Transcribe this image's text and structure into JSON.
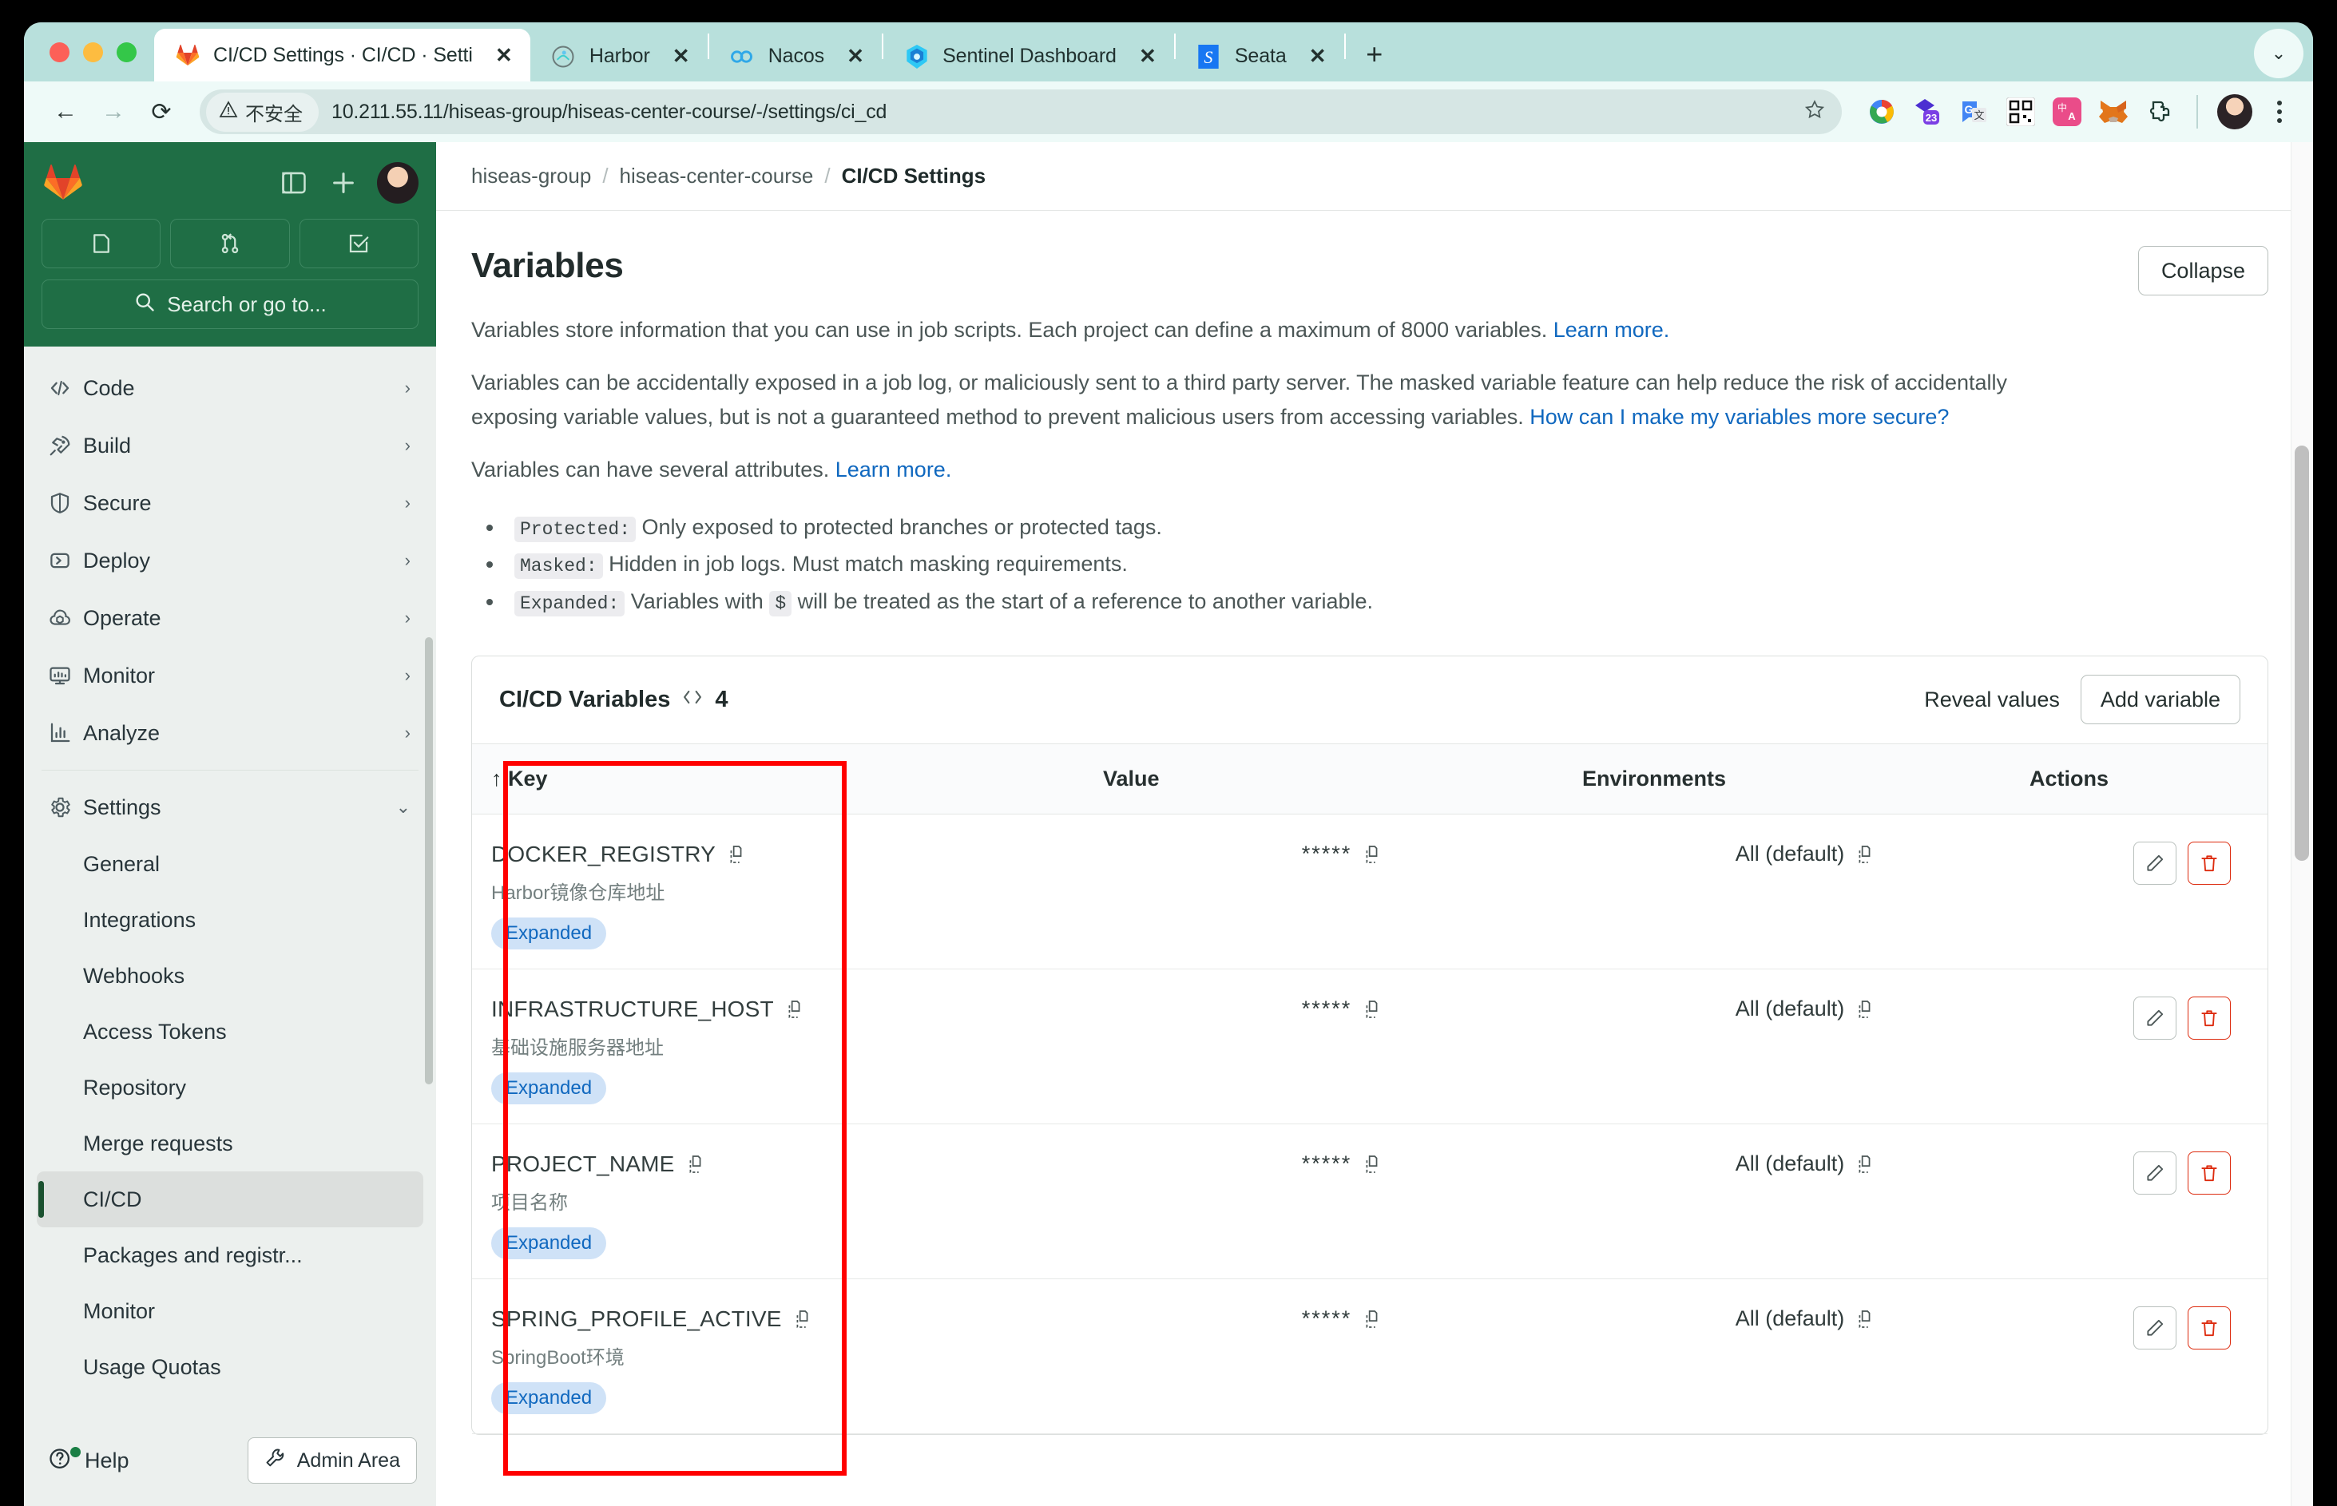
{
  "browser": {
    "tabs": [
      {
        "title": "CI/CD Settings · CI/CD · Setti",
        "favicon": "gitlab-icon",
        "active": true,
        "close_label": "✕"
      },
      {
        "title": "Harbor",
        "favicon": "harbor-icon",
        "active": false,
        "close_label": "✕"
      },
      {
        "title": "Nacos",
        "favicon": "nacos-icon",
        "active": false,
        "close_label": "✕"
      },
      {
        "title": "Sentinel Dashboard",
        "favicon": "sentinel-icon",
        "active": false,
        "close_label": "✕"
      },
      {
        "title": "Seata",
        "favicon": "seata-icon",
        "active": false,
        "close_label": "✕"
      }
    ],
    "new_tab_label": "+",
    "tab_list_chevron": "⌄",
    "nav": {
      "back": "←",
      "forward": "→",
      "reload": "⟳"
    },
    "omnibox": {
      "security_label": "不安全",
      "security_icon": "warning-triangle-icon",
      "url": "10.211.55.11/hiseas-group/hiseas-center-course/-/settings/ci_cd",
      "bookmark_icon": "star-icon"
    },
    "extensions": [
      "chrome-profile-icon",
      "super-extension-23-icon",
      "google-translate-icon",
      "qr-code-icon",
      "immersive-translate-icon",
      "metamask-fox-icon",
      "puzzle-extension-icon"
    ],
    "menu_icon": "kebab-menu-icon"
  },
  "sidebar": {
    "logo": "gitlab-logo-icon",
    "toggle_icon": "sidebar-toggle-icon",
    "create_icon": "plus-icon",
    "avatar": "user-avatar",
    "quick_actions": [
      "issues-icon",
      "merge-requests-icon",
      "todos-icon"
    ],
    "search_placeholder": "Search or go to...",
    "search_icon": "search-icon",
    "items": [
      {
        "label": "Code",
        "icon": "code-icon",
        "chevron": "›"
      },
      {
        "label": "Build",
        "icon": "rocket-icon",
        "chevron": "›"
      },
      {
        "label": "Secure",
        "icon": "shield-icon",
        "chevron": "›"
      },
      {
        "label": "Deploy",
        "icon": "deploy-icon",
        "chevron": "›"
      },
      {
        "label": "Operate",
        "icon": "cloud-pod-icon",
        "chevron": "›"
      },
      {
        "label": "Monitor",
        "icon": "monitor-icon",
        "chevron": "›"
      },
      {
        "label": "Analyze",
        "icon": "chart-icon",
        "chevron": "›"
      }
    ],
    "settings": {
      "label": "Settings",
      "icon": "gear-icon",
      "chevron": "⌄"
    },
    "settings_items": [
      {
        "label": "General",
        "active": false
      },
      {
        "label": "Integrations",
        "active": false
      },
      {
        "label": "Webhooks",
        "active": false
      },
      {
        "label": "Access Tokens",
        "active": false
      },
      {
        "label": "Repository",
        "active": false
      },
      {
        "label": "Merge requests",
        "active": false
      },
      {
        "label": "CI/CD",
        "active": true
      },
      {
        "label": "Packages and registr...",
        "active": false
      },
      {
        "label": "Monitor",
        "active": false
      },
      {
        "label": "Usage Quotas",
        "active": false
      }
    ],
    "help_label": "Help",
    "help_icon": "question-circle-icon",
    "admin_label": "Admin Area",
    "admin_icon": "wrench-icon"
  },
  "breadcrumb": {
    "items": [
      "hiseas-group",
      "hiseas-center-course"
    ],
    "current": "CI/CD Settings",
    "separator": "/"
  },
  "main": {
    "title": "Variables",
    "collapse_label": "Collapse",
    "desc1_text": "Variables store information that you can use in job scripts. Each project can define a maximum of 8000 variables. ",
    "desc1_link": "Learn more.",
    "desc2_text": "Variables can be accidentally exposed in a job log, or maliciously sent to a third party server. The masked variable feature can help reduce the risk of accidentally exposing variable values, but is not a guaranteed method to prevent malicious users from accessing variables. ",
    "desc2_link": "How can I make my variables more secure?",
    "desc3_text": "Variables can have several attributes. ",
    "desc3_link": "Learn more.",
    "attributes": [
      {
        "code": "Protected:",
        "text": " Only exposed to protected branches or protected tags."
      },
      {
        "code": "Masked:",
        "text": " Hidden in job logs. Must match masking requirements."
      },
      {
        "code": "Expanded:",
        "text_before": " Variables with ",
        "inline_code": "$",
        "text_after": " will be treated as the start of a reference to another variable."
      }
    ]
  },
  "variables_card": {
    "heading": "CI/CD Variables",
    "heading_icon": "code-brackets-icon",
    "count": "4",
    "reveal_label": "Reveal values",
    "add_label": "Add variable",
    "columns": {
      "key": "Key",
      "key_sort_icon": "↑",
      "value": "Value",
      "environments": "Environments",
      "actions": "Actions"
    },
    "rows": [
      {
        "key": "DOCKER_REGISTRY",
        "description": "Harbor镜像仓库地址",
        "badge": "Expanded",
        "value": "*****",
        "environment": "All (default)",
        "copy_icon": "copy-icon",
        "edit_icon": "pencil-icon",
        "delete_icon": "trash-icon"
      },
      {
        "key": "INFRASTRUCTURE_HOST",
        "description": "基础设施服务器地址",
        "badge": "Expanded",
        "value": "*****",
        "environment": "All (default)",
        "copy_icon": "copy-icon",
        "edit_icon": "pencil-icon",
        "delete_icon": "trash-icon"
      },
      {
        "key": "PROJECT_NAME",
        "description": "项目名称",
        "badge": "Expanded",
        "value": "*****",
        "environment": "All (default)",
        "copy_icon": "copy-icon",
        "edit_icon": "pencil-icon",
        "delete_icon": "trash-icon"
      },
      {
        "key": "SPRING_PROFILE_ACTIVE",
        "description": "SpringBoot环境",
        "badge": "Expanded",
        "value": "*****",
        "environment": "All (default)",
        "copy_icon": "copy-icon",
        "edit_icon": "pencil-icon",
        "delete_icon": "trash-icon"
      }
    ]
  },
  "annotation": {
    "color": "#ff0000",
    "shape": "rectangle-highlight"
  },
  "colors": {
    "gitlab_green": "#1f6e45",
    "link_blue": "#1068bf",
    "badge_bg": "#cfe2f7",
    "danger_red": "#dd2b0e",
    "tabstrip": "#b8e0dc"
  }
}
